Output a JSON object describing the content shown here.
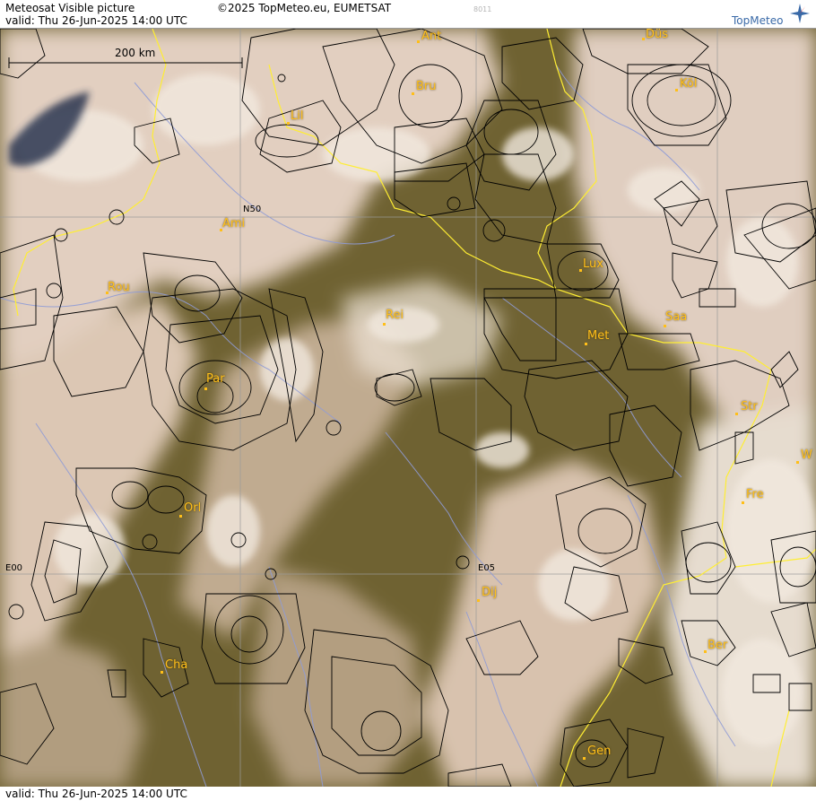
{
  "header": {
    "title": "Meteosat Visible picture",
    "valid": "valid:  Thu  26-Jun-2025  14:00 UTC",
    "copyright": "©2025 TopMeteo.eu, EUMETSAT",
    "code": "8011",
    "logo_text": "TopMeteo"
  },
  "footer": {
    "valid": "valid:  Thu  26-Jun-2025  14:00 UTC"
  },
  "scale": {
    "label": "200 km"
  },
  "grid_labels": {
    "lat_n50": "N50",
    "lon_e00": "E00",
    "lon_e05": "E05"
  },
  "colors": {
    "terrain": "#6f6232",
    "cloud": "#e8d6c6",
    "border": "#ffee33",
    "river": "#8f9bd6",
    "airspace": "#000000",
    "city": "#ffbf19"
  },
  "cities": {
    "ant": "Ant",
    "dus": "Düs",
    "bru": "Bru",
    "kol": "Köl",
    "lil": "Lil",
    "ami": "Ami",
    "rou": "Rou",
    "rei": "Rei",
    "lux": "Lux",
    "saa": "Saa",
    "met": "Met",
    "par": "Par",
    "str": "Str",
    "w": "W",
    "fre": "Fre",
    "orl": "Orl",
    "dij": "Dij",
    "cha": "Cha",
    "ber": "Ber",
    "gen": "Gen"
  }
}
